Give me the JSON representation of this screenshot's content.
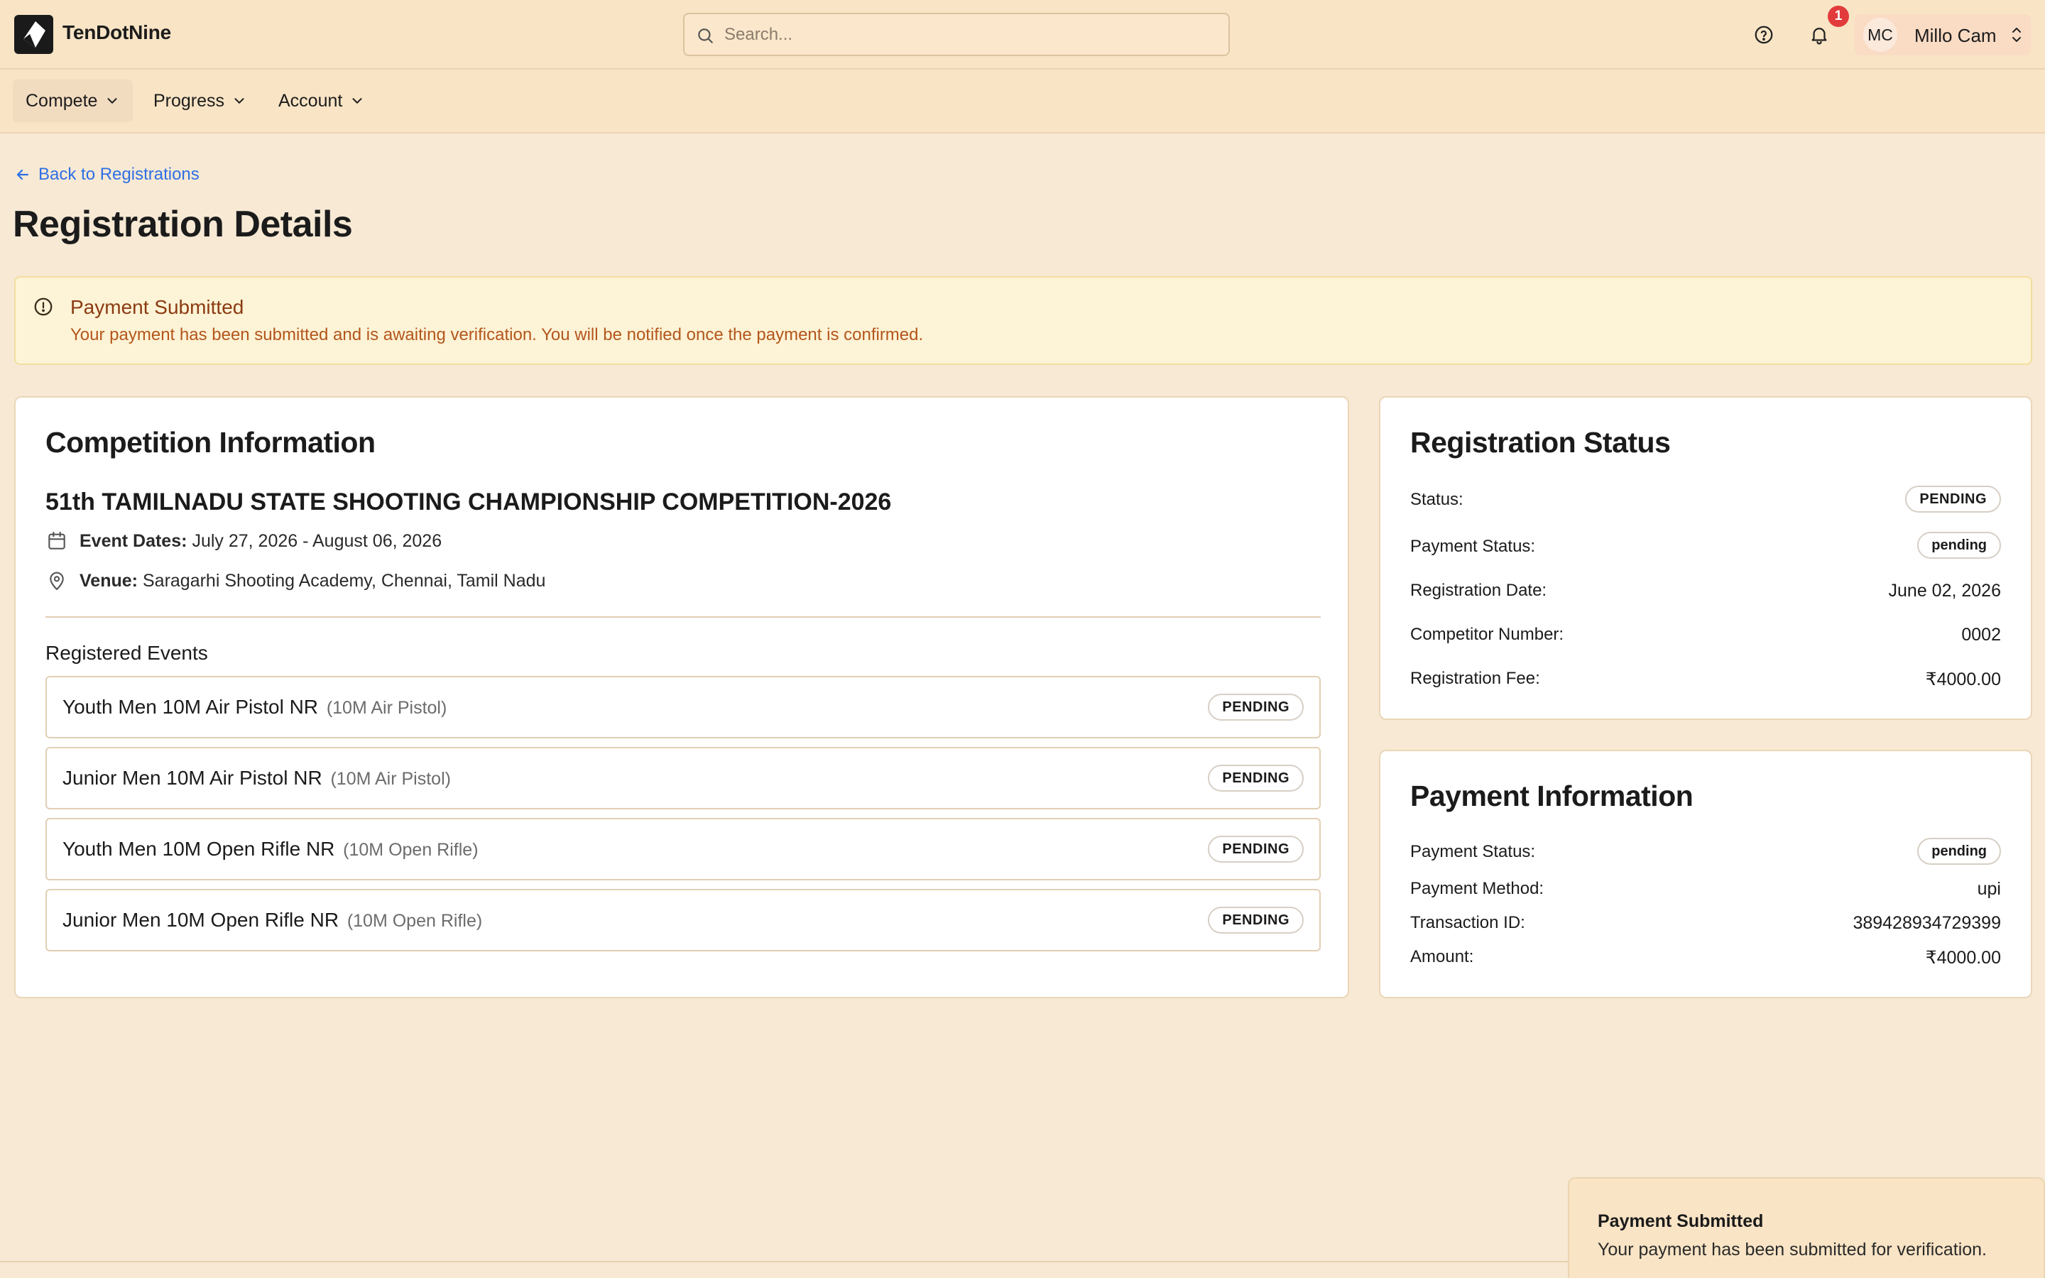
{
  "app": {
    "name": "TenDotNine"
  },
  "header": {
    "search_placeholder": "Search...",
    "notification_count": "1",
    "user": {
      "initials": "MC",
      "name": "Millo Cam"
    }
  },
  "nav": {
    "items": [
      {
        "label": "Compete",
        "active": true
      },
      {
        "label": "Progress"
      },
      {
        "label": "Account"
      }
    ]
  },
  "page": {
    "back_label": "Back to Registrations",
    "title": "Registration Details"
  },
  "alert": {
    "title": "Payment Submitted",
    "message": "Your payment has been submitted and is awaiting verification. You will be notified once the payment is confirmed."
  },
  "competition": {
    "heading": "Competition Information",
    "name": "51th TAMILNADU STATE SHOOTING CHAMPIONSHIP COMPETITION-2026",
    "dates_label": "Event Dates:",
    "dates_value": "July 27, 2026 - August 06, 2026",
    "venue_label": "Venue:",
    "venue_value": "Saragarhi Shooting Academy, Chennai, Tamil Nadu",
    "events_label": "Registered Events",
    "events": [
      {
        "name": "Youth Men 10M Air Pistol NR",
        "type": "(10M Air Pistol)",
        "status": "PENDING"
      },
      {
        "name": "Junior Men 10M Air Pistol NR",
        "type": "(10M Air Pistol)",
        "status": "PENDING"
      },
      {
        "name": "Youth Men 10M Open Rifle NR",
        "type": "(10M Open Rifle)",
        "status": "PENDING"
      },
      {
        "name": "Junior Men 10M Open Rifle NR",
        "type": "(10M Open Rifle)",
        "status": "PENDING"
      }
    ]
  },
  "registration_status": {
    "heading": "Registration Status",
    "status_label": "Status:",
    "status_value": "PENDING",
    "payment_status_label": "Payment Status:",
    "payment_status_value": "pending",
    "date_label": "Registration Date:",
    "date_value": "June 02, 2026",
    "competitor_label": "Competitor Number:",
    "competitor_value": "0002",
    "fee_label": "Registration Fee:",
    "fee_value": "₹4000.00"
  },
  "payment_info": {
    "heading": "Payment Information",
    "status_label": "Payment Status:",
    "status_value": "pending",
    "method_label": "Payment Method:",
    "method_value": "upi",
    "txn_label": "Transaction ID:",
    "txn_value": "389428934729399",
    "amount_label": "Amount:",
    "amount_value": "₹4000.00"
  },
  "toast": {
    "title": "Payment Submitted",
    "message": "Your payment has been submitted for verification."
  },
  "colors": {
    "background": "#f7e9d4",
    "header": "#f9e4c5",
    "link": "#2f6fe4",
    "alert_title": "#8a3b12",
    "alert_text": "#b3561c",
    "notification": "#e23b3b"
  }
}
